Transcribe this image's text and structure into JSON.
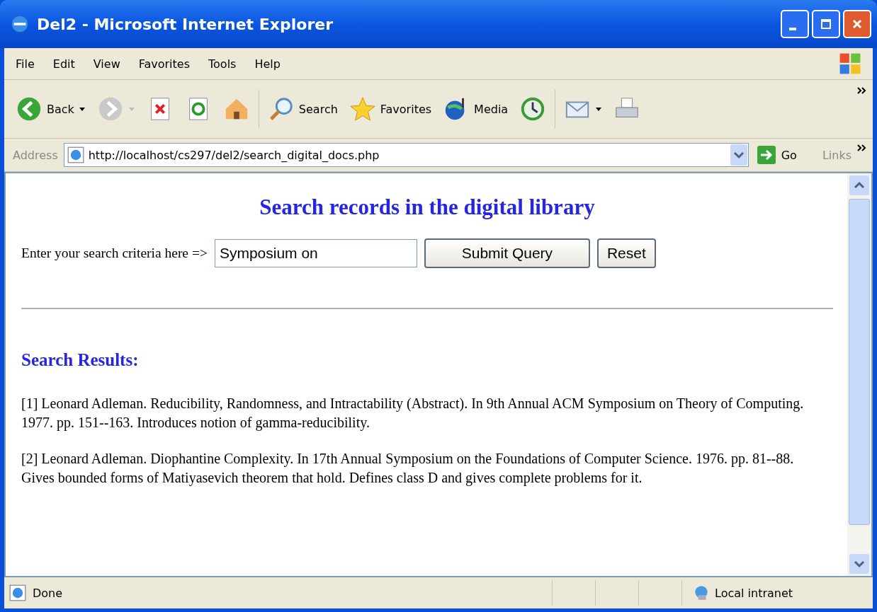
{
  "window": {
    "title": "Del2 - Microsoft Internet Explorer"
  },
  "menu": [
    "File",
    "Edit",
    "View",
    "Favorites",
    "Tools",
    "Help"
  ],
  "toolbar": [
    {
      "kind": "back",
      "label": "Back"
    },
    {
      "kind": "forward"
    },
    {
      "kind": "stop"
    },
    {
      "kind": "refresh"
    },
    {
      "kind": "home"
    },
    {
      "kind": "search",
      "label": "Search"
    },
    {
      "kind": "favorites",
      "label": "Favorites"
    },
    {
      "kind": "media",
      "label": "Media"
    },
    {
      "kind": "history"
    },
    {
      "kind": "mail"
    },
    {
      "kind": "print"
    }
  ],
  "address_bar": {
    "label": "Address",
    "url": "http://localhost/cs297/del2/search_digital_docs.php",
    "go": "Go",
    "links": "Links"
  },
  "page": {
    "heading": "Search records in the digital library",
    "search_label": "Enter your search criteria here =>",
    "search_value": "Symposium on",
    "buttons": [
      "Submit Query",
      "Reset"
    ],
    "results_heading": "Search Results:",
    "results": [
      "[1] Leonard Adleman. Reducibility, Randomness, and Intractability (Abstract). In 9th Annual ACM Symposium on Theory of Computing. 1977. pp. 151--163. Introduces notion of gamma-reducibility.",
      "[2] Leonard Adleman. Diophantine Complexity. In 17th Annual Symposium on the Foundations of Computer Science. 1976. pp. 81--88. Gives bounded forms of Matiyasevich theorem that hold. Defines class D and gives complete problems for it."
    ]
  },
  "status_bar": {
    "text": "Done",
    "zone": "Local intranet"
  }
}
